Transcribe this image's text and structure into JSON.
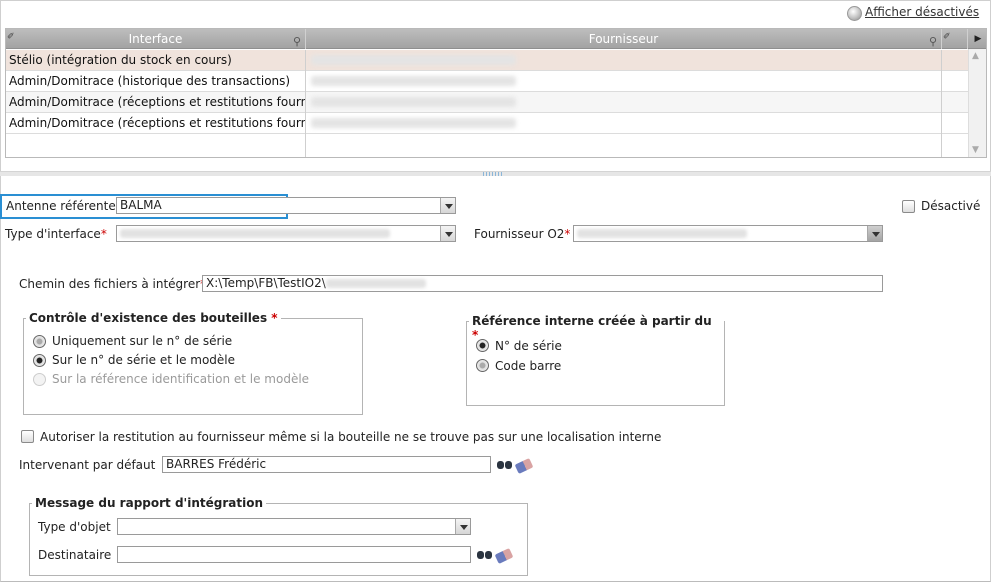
{
  "header": {
    "show_disabled_label": "Afficher désactivés"
  },
  "grid": {
    "columns": [
      "Interface",
      "Fournisseur"
    ],
    "rows": [
      {
        "interface": "Stélio (intégration du stock en cours)"
      },
      {
        "interface": "Admin/Domitrace (historique des transactions)"
      },
      {
        "interface": "Admin/Domitrace (réceptions et restitutions fournis"
      },
      {
        "interface": "Admin/Domitrace (réceptions et restitutions fournis"
      }
    ]
  },
  "form": {
    "antenne_label": "Antenne référente",
    "antenne_value": "BALMA",
    "desactive_label": "Désactivé",
    "type_interface_label": "Type d'interface",
    "fournisseur_label": "Fournisseur O2",
    "chemin_label": "Chemin des fichiers à intégrer",
    "chemin_value": "X:\\Temp\\FB\\TestIO2\\",
    "required_mark": "*",
    "controle": {
      "legend": "Contrôle d'existence des bouteilles",
      "options": [
        "Uniquement sur le n° de série",
        "Sur le n° de série et le modèle",
        "Sur la référence identification et le modèle"
      ]
    },
    "reference": {
      "legend": "Référence interne créée à partir du",
      "options": [
        "N° de série",
        "Code barre"
      ]
    },
    "autoriser_label": "Autoriser la restitution au fournisseur même si la bouteille ne se trouve pas sur une localisation interne",
    "intervenant_label": "Intervenant par défaut",
    "intervenant_value": "BARRES Frédéric",
    "message": {
      "legend": "Message du rapport d'intégration",
      "type_objet_label": "Type d'objet",
      "destinataire_label": "Destinataire"
    }
  }
}
